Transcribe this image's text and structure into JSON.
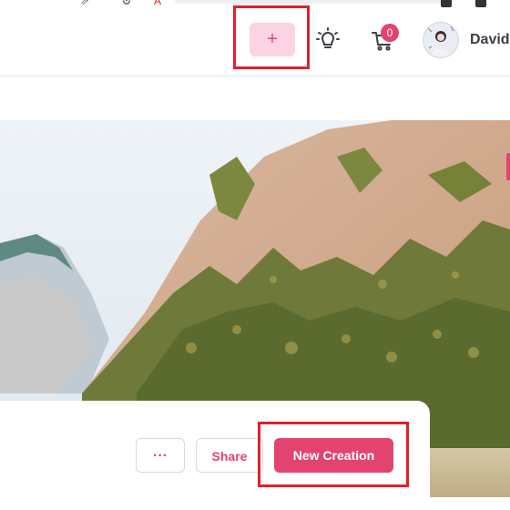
{
  "header": {
    "create_plus_label": "+",
    "cart_count": "0",
    "user_name": "David"
  },
  "card": {
    "more_label": "···",
    "share_label": "Share",
    "new_creation_label": "New Creation"
  },
  "colors": {
    "accent": "#e2446f",
    "plus_bg": "#fbd3e2",
    "highlight": "#e0202a"
  },
  "icons": {
    "create": "plus-icon",
    "ideas": "lightbulb-icon",
    "cart": "cart-icon",
    "more": "more-dots-icon"
  }
}
